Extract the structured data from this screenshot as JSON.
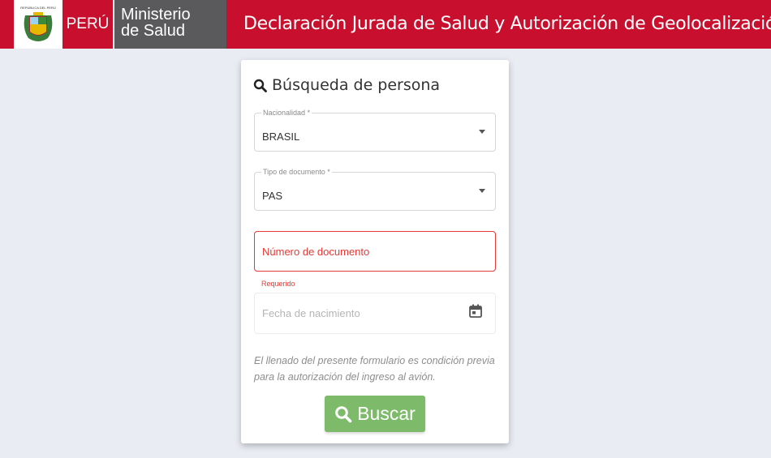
{
  "header": {
    "country": "PERÚ",
    "ministry_line1": "Ministerio",
    "ministry_line2": "de Salud",
    "title": "Declaración Jurada de Salud y Autorización de Geolocalización",
    "crest_text": "REPÚBLICA DEL PERÚ",
    "colors": {
      "brand_red": "#c8102e",
      "ministry_gray": "#5a5a5c"
    }
  },
  "card": {
    "title": "Búsqueda de persona",
    "title_icon": "search-icon",
    "nationality": {
      "label": "Nacionalidad *",
      "value": "BRASIL"
    },
    "document_type": {
      "label": "Tipo de documento *",
      "value": "PAS"
    },
    "document_number": {
      "placeholder": "Número de documento",
      "error": "Requerido"
    },
    "birth_date": {
      "placeholder": "Fecha de nacimiento",
      "icon": "calendar-icon"
    },
    "note": "El llenado del presente formulario es condición previa para la autorización del ingreso al avión.",
    "search_button": "Buscar",
    "colors": {
      "error": "#e53935",
      "button": "#7dbb6a"
    }
  }
}
